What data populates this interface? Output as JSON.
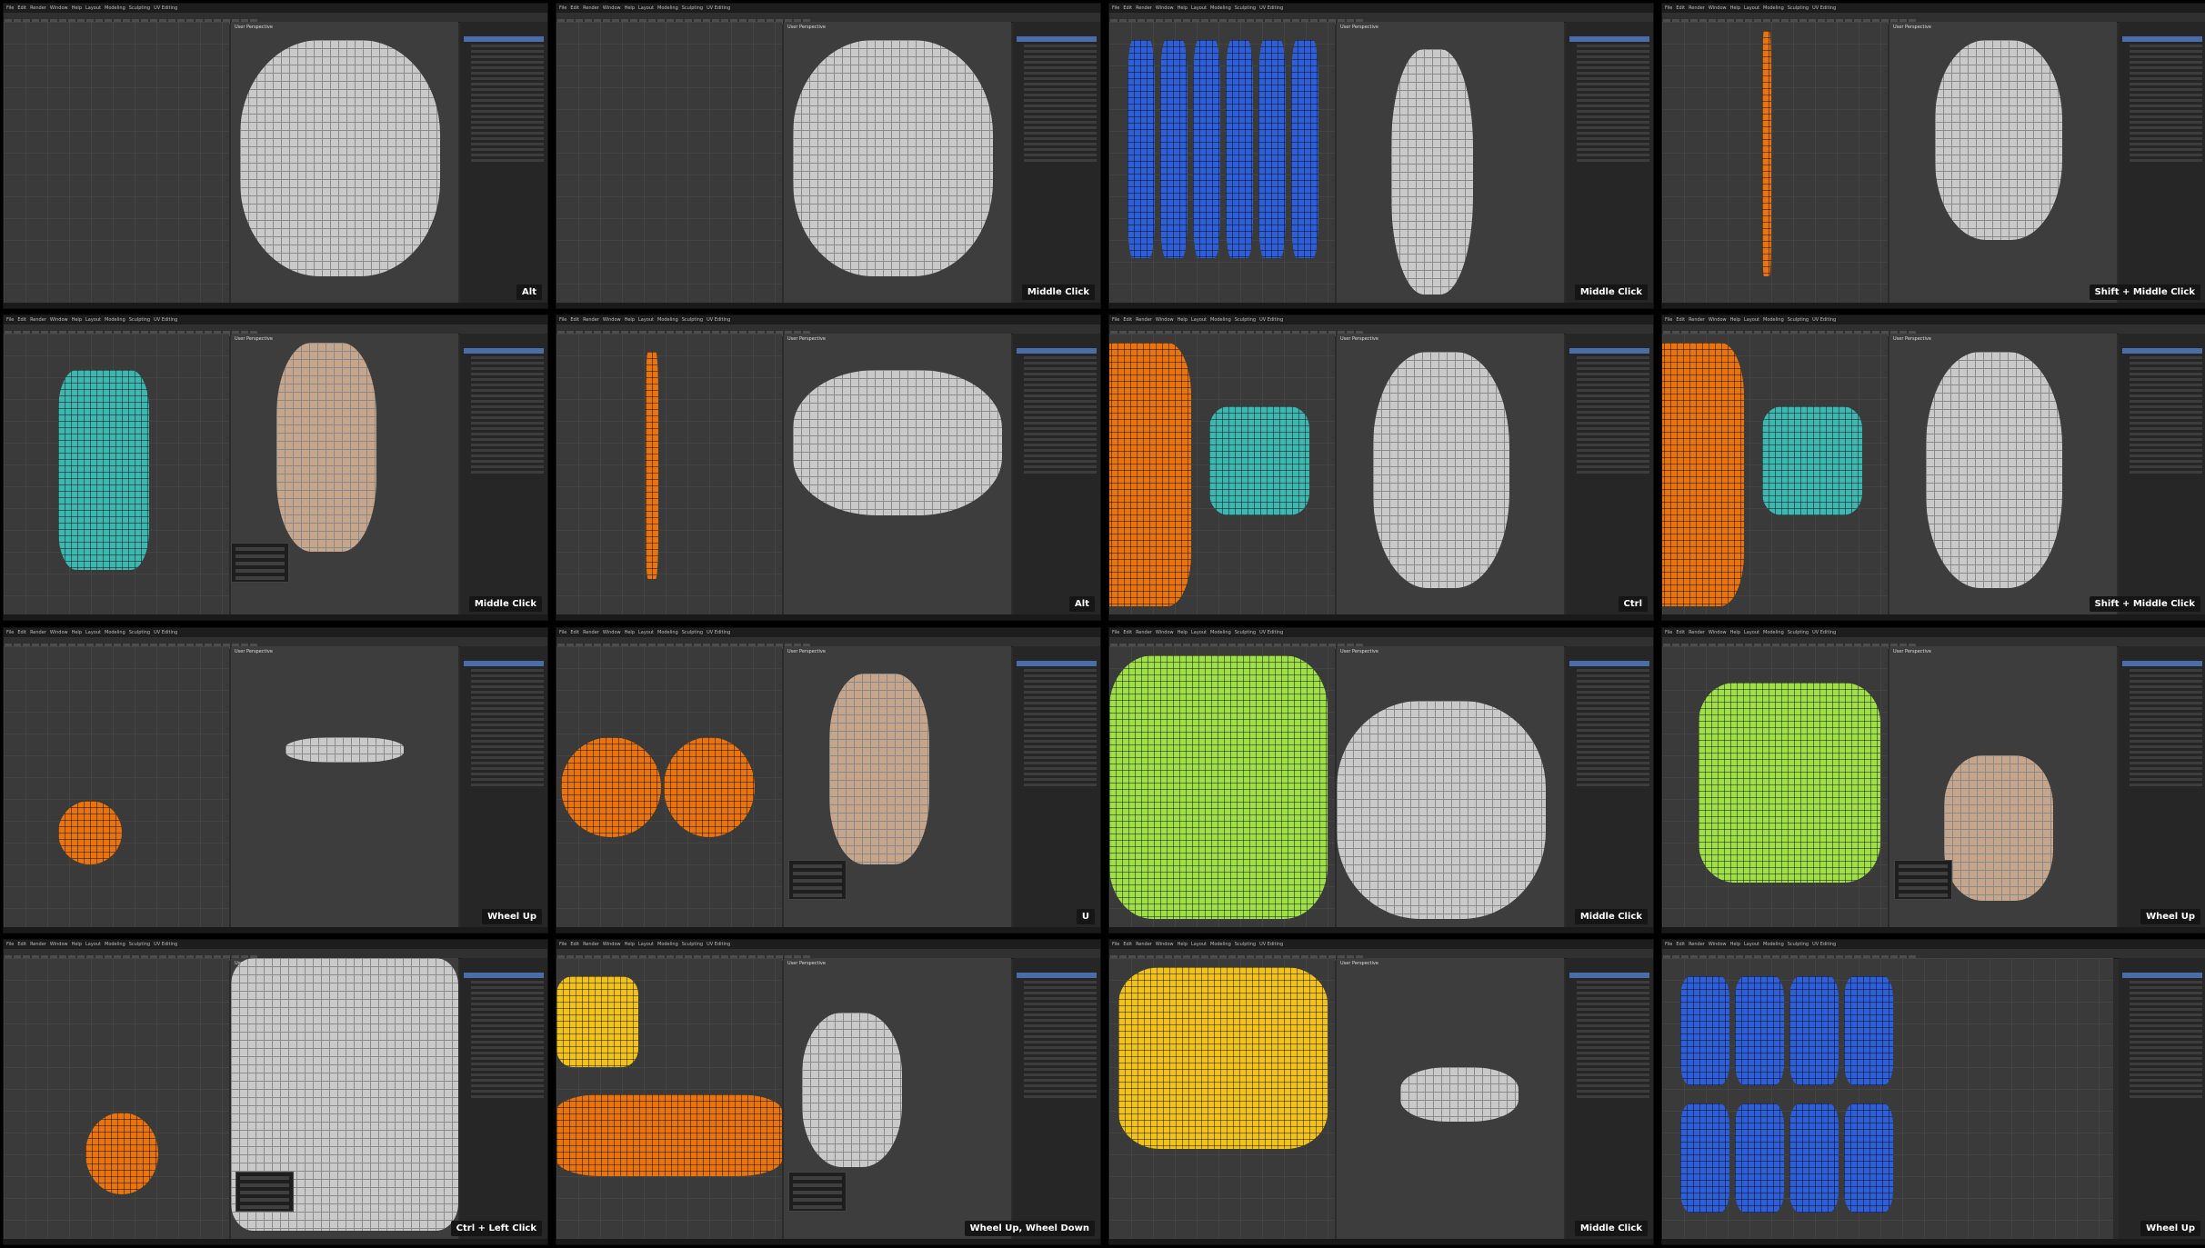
{
  "app": {
    "menu": [
      "File",
      "Edit",
      "Render",
      "Window",
      "Help"
    ],
    "workspace_tabs": [
      "Layout",
      "Modeling",
      "Sculpting",
      "UV Editing"
    ],
    "viewport_label": "User Perspective"
  },
  "colors": {
    "uv_orange": "#e8740e",
    "uv_blue": "#2f5fd6",
    "uv_teal": "#3fb6b0",
    "uv_green": "#9fe04a",
    "uv_yellow": "#f0c21a",
    "selection_blue": "#4a6da8",
    "hint_bg": "#151515"
  },
  "frames": [
    {
      "hint": "Alt",
      "variant": "mesh-closeup"
    },
    {
      "hint": "Middle Click",
      "variant": "mesh-closeup"
    },
    {
      "hint": "Middle Click",
      "variant": "uv-blue-grid"
    },
    {
      "hint": "Shift + Middle Click",
      "variant": "full-body"
    },
    {
      "hint": "Middle Click",
      "variant": "hand-skin"
    },
    {
      "hint": "Alt",
      "variant": "body-side"
    },
    {
      "hint": "Ctrl",
      "variant": "leg-orange"
    },
    {
      "hint": "Shift + Middle Click",
      "variant": "leg-orange"
    },
    {
      "hint": "Wheel Up",
      "variant": "arm-pin"
    },
    {
      "hint": "U",
      "variant": "head-skin"
    },
    {
      "hint": "Middle Click",
      "variant": "green-closeup"
    },
    {
      "hint": "Wheel Up",
      "variant": "green-skin"
    },
    {
      "hint": "Ctrl + Left Click",
      "variant": "mouth-closeup"
    },
    {
      "hint": "Wheel Up, Wheel Down",
      "variant": "orange-strip"
    },
    {
      "hint": "Middle Click",
      "variant": "yellow-jaw"
    },
    {
      "hint": "Wheel Up",
      "variant": "fullscreen-uv"
    }
  ]
}
